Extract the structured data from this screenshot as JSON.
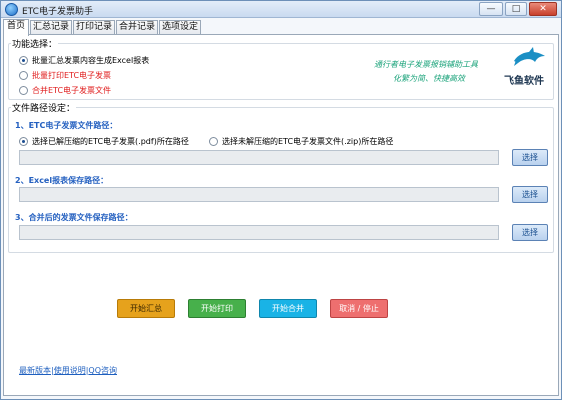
{
  "window": {
    "title": "ETC电子发票助手"
  },
  "titlebar_buttons": {
    "minimize": "—",
    "maximize": "□",
    "close": "✕"
  },
  "tabs": [
    {
      "label": "首页"
    },
    {
      "label": "汇总记录"
    },
    {
      "label": "打印记录"
    },
    {
      "label": "合并记录"
    },
    {
      "label": "选项设定"
    }
  ],
  "function_group": {
    "title": "功能选择：",
    "options": [
      {
        "label": "批量汇总发票内容生成Excel报表",
        "checked": true
      },
      {
        "label": "批量打印ETC电子发票",
        "checked": false
      },
      {
        "label": "合并ETC电子发票文件",
        "checked": false
      }
    ],
    "slogan_line1": "通行者电子发票报销辅助工具",
    "slogan_line2": "化繁为简、快捷高效",
    "logo_text": "飞鱼软件",
    "logo_icon": "dolphin-icon"
  },
  "path_group": {
    "title": "文件路径设定：",
    "section1": {
      "label": "1、ETC电子发票文件路径：",
      "radio1": "选择已解压缩的ETC电子发票(.pdf)所在路径",
      "radio2": "选择未解压缩的ETC电子发票文件(.zip)所在路径",
      "button": "选择"
    },
    "section2": {
      "label": "2、Excel报表保存路径：",
      "button": "选择"
    },
    "section3": {
      "label": "3、合并后的发票文件保存路径：",
      "button": "选择"
    }
  },
  "actions": {
    "summary": "开始汇总",
    "print": "开始打印",
    "merge": "开始合并",
    "cancel": "取消 / 停止"
  },
  "footer_links": {
    "latest": "最新版本",
    "sep1": "|",
    "help": "使用说明",
    "sep2": "|",
    "qq": "QQ咨询"
  },
  "colors": {
    "summary": "#e6a21c",
    "print": "#47b04b",
    "merge": "#19b3e6",
    "cancel": "#ee6f6f",
    "section_label": "#2460c0",
    "slogan": "#1aa37a"
  }
}
